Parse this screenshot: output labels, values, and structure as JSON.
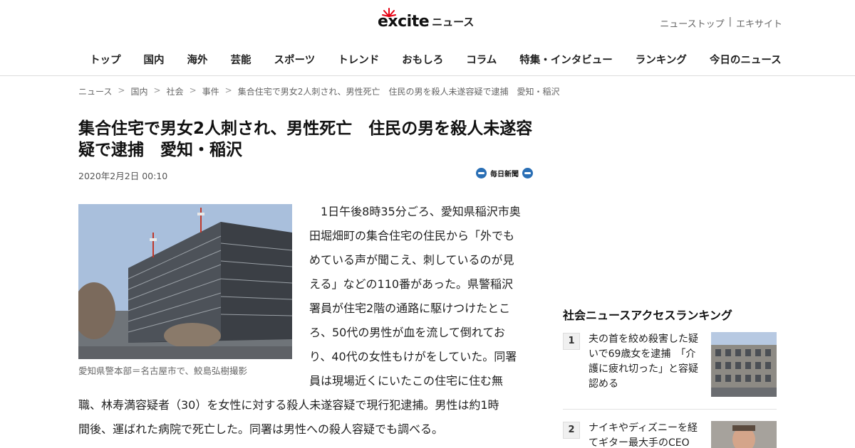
{
  "header": {
    "logo_text": "excite",
    "logo_suffix": "ニュース",
    "top_links": [
      "ニューストップ",
      "|",
      "エキサイト"
    ],
    "nav": [
      "トップ",
      "国内",
      "海外",
      "芸能",
      "スポーツ",
      "トレンド",
      "おもしろ",
      "コラム",
      "特集・インタビュー",
      "ランキング",
      "今日のニュース"
    ]
  },
  "breadcrumb": [
    "ニュース",
    "国内",
    "社会",
    "事件",
    "集合住宅で男女2人刺され、男性死亡　住民の男を殺人未遂容疑で逮捕　愛知・稲沢"
  ],
  "article": {
    "title": "集合住宅で男女2人刺され、男性死亡　住民の男を殺人未遂容疑で逮捕　愛知・稲沢",
    "date": "2020年2月2日 00:10",
    "source": "毎日新聞",
    "caption": "愛知県警本部＝名古屋市で、鮫島弘樹撮影",
    "body_lines": [
      "　1日午後8時35分ごろ、愛知県稲沢市奥",
      "田堀畑町の集合住宅の住民から「外でも",
      "めている声が聞こえ、刺しているのが見",
      "える」などの110番があった。県警稲沢",
      "署員が住宅2階の通路に駆けつけたとこ",
      "ろ、50代の男性が血を流して倒れてお",
      "り、40代の女性もけがをしていた。同署",
      "員は現場近くにいたこの住宅に住む無",
      "職、林寿満容疑者（30）を女性に対する殺人未遂容疑で現行犯逮捕。男性は約1時",
      "間後、運ばれた病院で死亡した。同署は男性への殺人容疑でも調べる。"
    ]
  },
  "sidebar": {
    "ranking_title": "社会ニュースアクセスランキング",
    "items": [
      {
        "rank": "1",
        "text": "夫の首を絞め殺害した疑いで69歳女を逮捕　「介護に疲れ切った」と容疑認める"
      },
      {
        "rank": "2",
        "text": "ナイキやディズニーを経てギター最大手のCEO"
      }
    ]
  },
  "colors": {
    "brand_red": "#e60012",
    "text": "#222222",
    "muted": "#666666",
    "border": "#dcdcdc"
  }
}
